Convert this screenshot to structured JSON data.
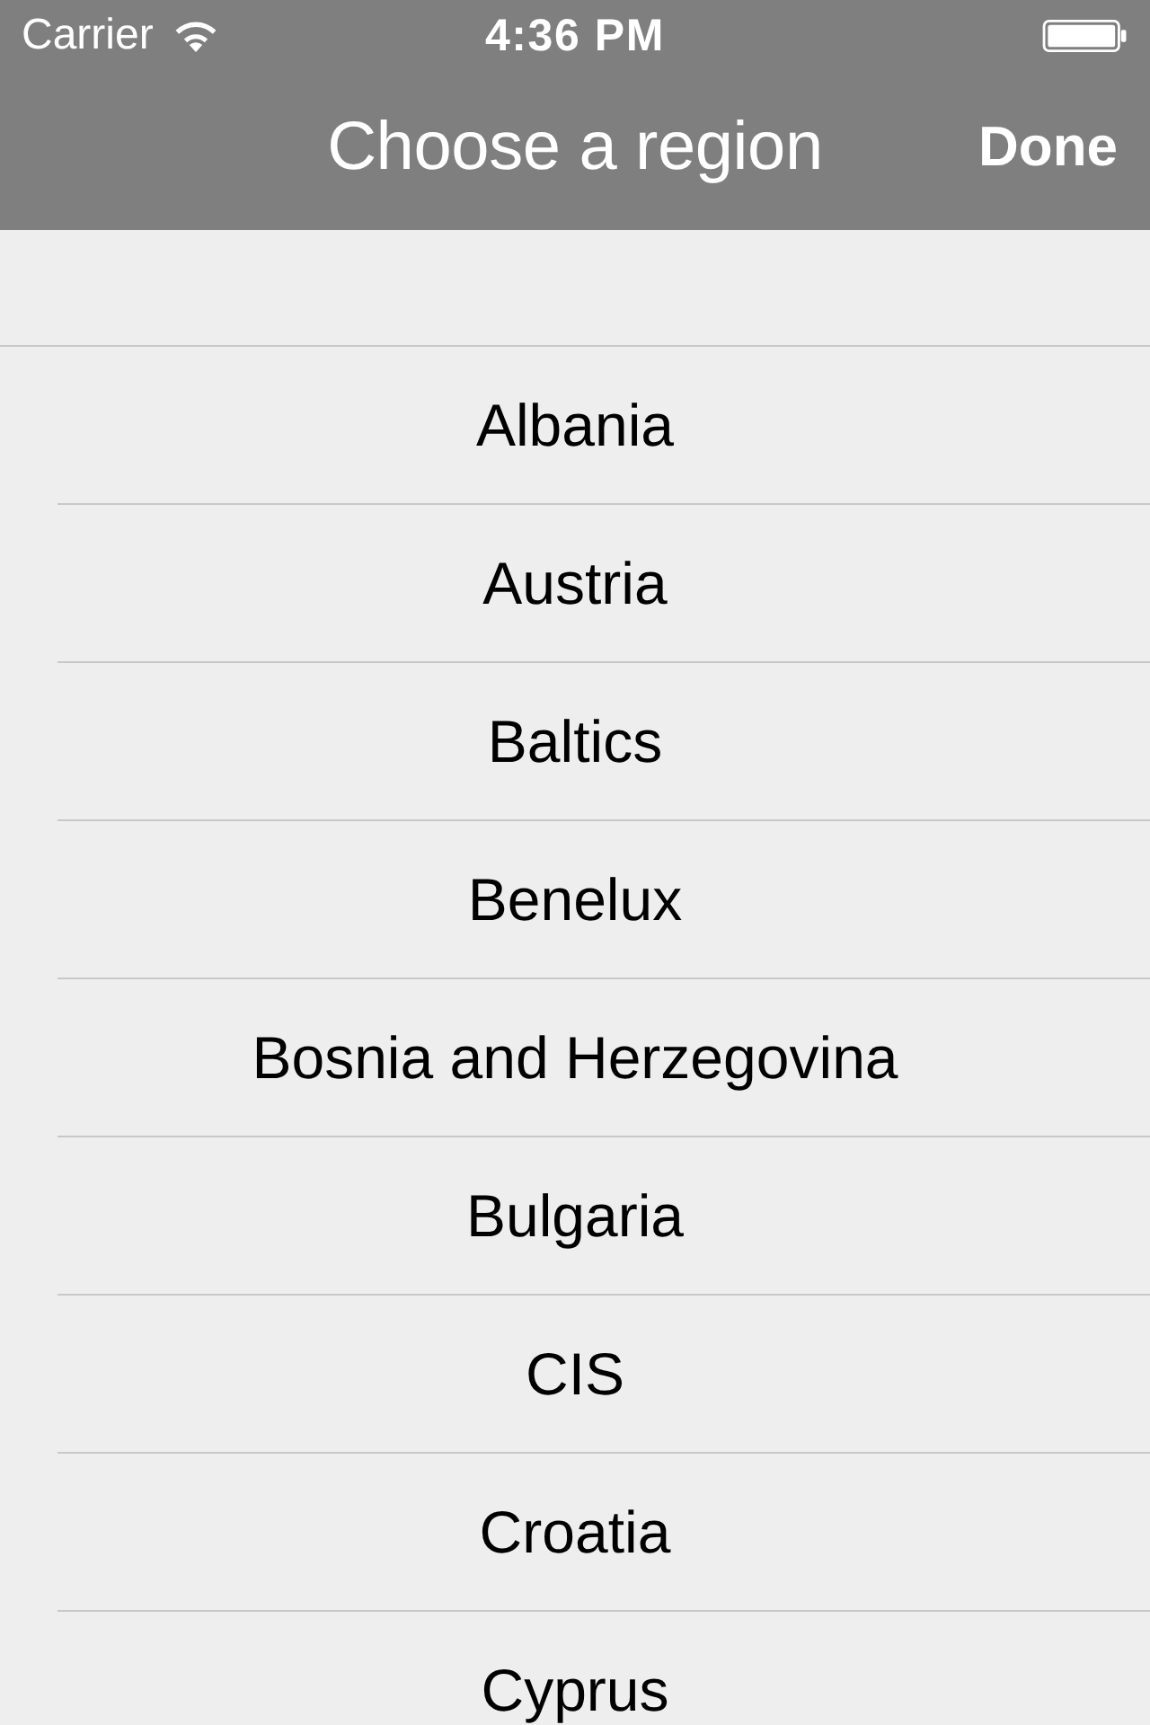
{
  "status_bar": {
    "carrier": "Carrier",
    "time": "4:36 PM"
  },
  "nav_bar": {
    "title": "Choose a region",
    "done_button": "Done"
  },
  "regions": [
    {
      "name": "Albania"
    },
    {
      "name": "Austria"
    },
    {
      "name": "Baltics"
    },
    {
      "name": "Benelux"
    },
    {
      "name": "Bosnia and Herzegovina"
    },
    {
      "name": "Bulgaria"
    },
    {
      "name": "CIS"
    },
    {
      "name": "Croatia"
    },
    {
      "name": "Cyprus"
    }
  ]
}
